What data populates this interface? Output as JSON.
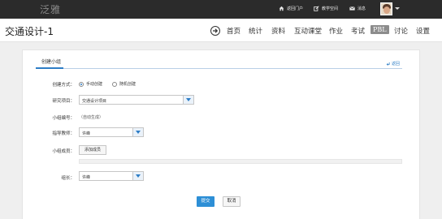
{
  "topbar": {
    "logo": "泛雅",
    "links": [
      {
        "label": "返回门户",
        "icon": "home-icon"
      },
      {
        "label": "教学空间",
        "icon": "edit-icon"
      },
      {
        "label": "消息",
        "icon": "mail-icon"
      }
    ]
  },
  "course": {
    "title": "交通设计-1",
    "nav": [
      {
        "label": "首页"
      },
      {
        "label": "统计"
      },
      {
        "label": "资料"
      },
      {
        "label": "互动课堂"
      },
      {
        "label": "作业"
      },
      {
        "label": "考试"
      },
      {
        "label": "PBL",
        "active": true
      },
      {
        "label": "讨论"
      },
      {
        "label": "设置"
      }
    ]
  },
  "form": {
    "tab_label": "创建小组",
    "back_label": "返回",
    "create_mode_label": "创建方式：",
    "mode_manual": "手动创建",
    "mode_random": "随机创建",
    "project_label": "研究项目：",
    "project_value": "交通设计项目",
    "group_no_label": "小组编号：",
    "group_no_value": "（自动生成）",
    "teacher_label": "指导教师：",
    "teacher_value": "许峰",
    "members_label": "小组成员：",
    "add_member_label": "添加成员",
    "leader_label": "组长：",
    "leader_value": "许峰",
    "submit_label": "提交",
    "cancel_label": "取消"
  },
  "colors": {
    "topbar": "#2b2b2b",
    "accent": "#2d7dc6",
    "submit": "#2d8fd6"
  }
}
